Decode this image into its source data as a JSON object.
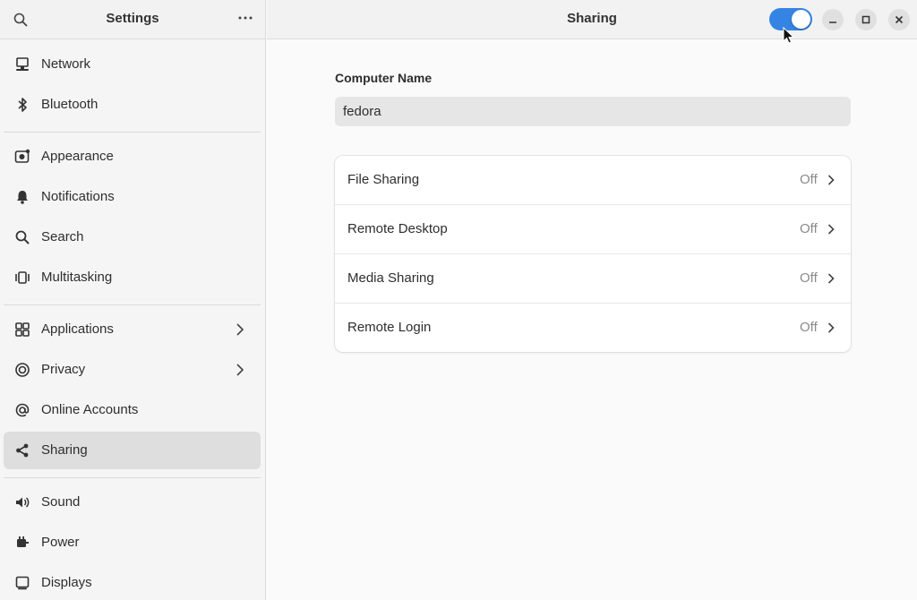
{
  "sidebar": {
    "title": "Settings",
    "items": [
      {
        "label": "Network",
        "icon": "network-icon"
      },
      {
        "label": "Bluetooth",
        "icon": "bluetooth-icon"
      },
      {
        "label": "Appearance",
        "icon": "appearance-icon"
      },
      {
        "label": "Notifications",
        "icon": "bell-icon"
      },
      {
        "label": "Search",
        "icon": "search-icon"
      },
      {
        "label": "Multitasking",
        "icon": "multitasking-icon"
      },
      {
        "label": "Applications",
        "icon": "grid-icon"
      },
      {
        "label": "Privacy",
        "icon": "privacy-icon"
      },
      {
        "label": "Online Accounts",
        "icon": "at-icon"
      },
      {
        "label": "Sharing",
        "icon": "share-icon"
      },
      {
        "label": "Sound",
        "icon": "speaker-icon"
      },
      {
        "label": "Power",
        "icon": "power-icon"
      },
      {
        "label": "Displays",
        "icon": "display-icon"
      }
    ]
  },
  "header": {
    "title": "Sharing",
    "sharing_toggle_on": true
  },
  "computer_name": {
    "label": "Computer Name",
    "value": "fedora"
  },
  "services": [
    {
      "label": "File Sharing",
      "status": "Off"
    },
    {
      "label": "Remote Desktop",
      "status": "Off"
    },
    {
      "label": "Media Sharing",
      "status": "Off"
    },
    {
      "label": "Remote Login",
      "status": "Off"
    }
  ],
  "colors": {
    "accent": "#3584e4",
    "selected_row": "#dedede"
  }
}
